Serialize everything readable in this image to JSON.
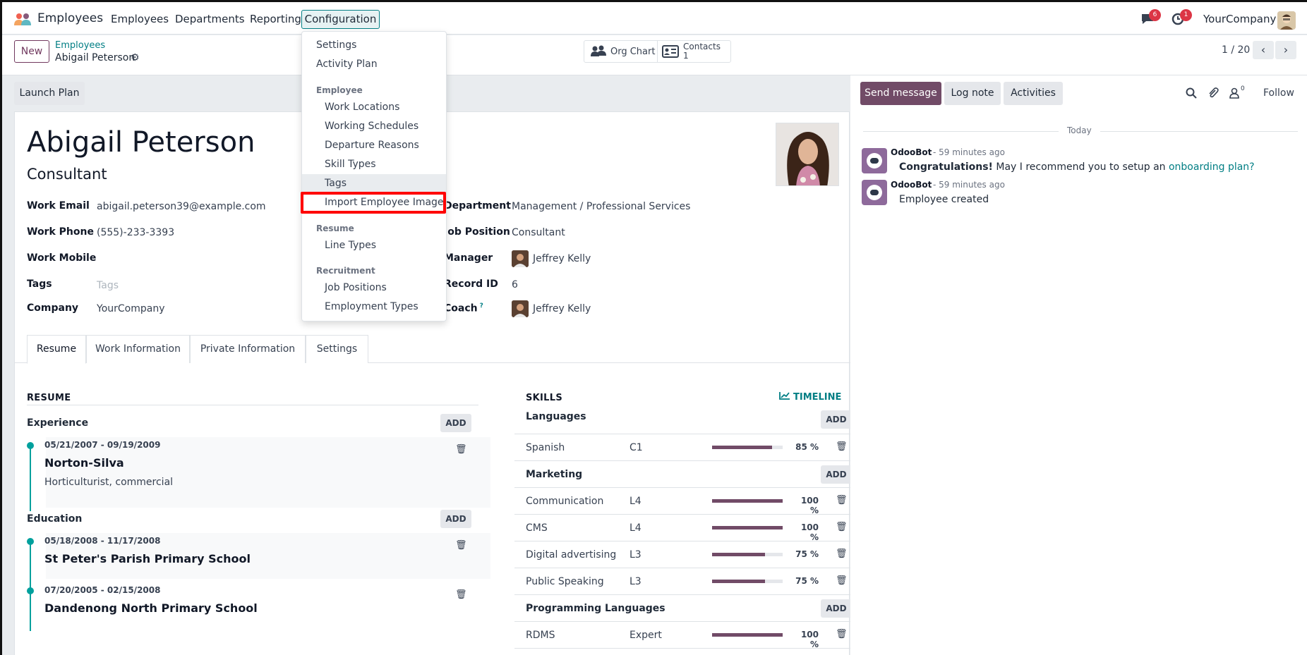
{
  "navbar": {
    "app_name": "Employees",
    "menus": [
      "Employees",
      "Departments",
      "Reporting"
    ],
    "config_menu": "Configuration",
    "messages_badge": "6",
    "activities_badge": "1",
    "company": "YourCompany"
  },
  "control_panel": {
    "new_label": "New",
    "breadcrumb_parent": "Employees",
    "breadcrumb_current": "Abigail Peterson",
    "org_chart_label": "Org Chart",
    "contacts_label": "Contacts",
    "contacts_count": "1",
    "pager": "1 / 20"
  },
  "statusbar": {
    "launch_plan": "Launch Plan"
  },
  "employee": {
    "name": "Abigail Peterson",
    "job_title": "Consultant",
    "left_fields": [
      {
        "label": "Work Email",
        "value": "abigail.peterson39@example.com"
      },
      {
        "label": "Work Phone",
        "value": "(555)-233-3393"
      },
      {
        "label": "Work Mobile",
        "value": ""
      },
      {
        "label": "Tags",
        "value": "Tags"
      },
      {
        "label": "Company",
        "value": "YourCompany"
      }
    ],
    "right_fields": [
      {
        "label": "Department",
        "value": "Management / Professional Services"
      },
      {
        "label": "Job Position",
        "value": "Consultant"
      },
      {
        "label": "Manager",
        "value": "Jeffrey Kelly"
      },
      {
        "label": "Record ID",
        "value": "6"
      },
      {
        "label": "Coach",
        "value": "Jeffrey Kelly",
        "help": "?"
      }
    ]
  },
  "tabs": [
    "Resume",
    "Work Information",
    "Private Information",
    "Settings"
  ],
  "resume": {
    "title": "RESUME",
    "add_label": "ADD",
    "experience_label": "Experience",
    "education_label": "Education",
    "experience": [
      {
        "dates": "05/21/2007 - 09/19/2009",
        "title": "Norton-Silva",
        "desc": "Horticulturist, commercial"
      }
    ],
    "education": [
      {
        "dates": "05/18/2008 - 11/17/2008",
        "title": "St Peter's Parish Primary School"
      },
      {
        "dates": "07/20/2005 - 02/15/2008",
        "title": "Dandenong North Primary School"
      }
    ]
  },
  "skills": {
    "title": "SKILLS",
    "timeline_label": "TIMELINE",
    "add_label": "ADD",
    "groups": [
      {
        "name": "Languages",
        "items": [
          {
            "name": "Spanish",
            "level": "C1",
            "progress": 85,
            "pct": "85 %"
          }
        ]
      },
      {
        "name": "Marketing",
        "items": [
          {
            "name": "Communication",
            "level": "L4",
            "progress": 100,
            "pct": "100 %"
          },
          {
            "name": "CMS",
            "level": "L4",
            "progress": 100,
            "pct": "100 %"
          },
          {
            "name": "Digital advertising",
            "level": "L3",
            "progress": 75,
            "pct": "75 %"
          },
          {
            "name": "Public Speaking",
            "level": "L3",
            "progress": 75,
            "pct": "75 %"
          }
        ]
      },
      {
        "name": "Programming Languages",
        "items": [
          {
            "name": "RDMS",
            "level": "Expert",
            "progress": 100,
            "pct": "100 %"
          }
        ]
      }
    ]
  },
  "chatter": {
    "send_message": "Send message",
    "log_note": "Log note",
    "activities": "Activities",
    "followers_count": "0",
    "follow": "Follow",
    "today": "Today",
    "messages": [
      {
        "author": "OdooBot",
        "time": "- 59 minutes ago",
        "bold": "Congratulations!",
        "text": " May I recommend you to setup an ",
        "link": "onboarding plan?"
      },
      {
        "author": "OdooBot",
        "time": "- 59 minutes ago",
        "text": "Employee created"
      }
    ]
  },
  "dropdown": {
    "settings": "Settings",
    "activity_plan": "Activity Plan",
    "employee_header": "Employee",
    "work_locations": "Work Locations",
    "working_schedules": "Working Schedules",
    "departure_reasons": "Departure Reasons",
    "skill_types": "Skill Types",
    "tags": "Tags",
    "import_employee_image": "Import Employee Image",
    "resume_header": "Resume",
    "line_types": "Line Types",
    "recruitment_header": "Recruitment",
    "job_positions": "Job Positions",
    "employment_types": "Employment Types"
  },
  "colors": {
    "brand": "#714b67",
    "accent": "#017e84",
    "timeline": "#00a09d",
    "highlight": "#ff0000"
  }
}
